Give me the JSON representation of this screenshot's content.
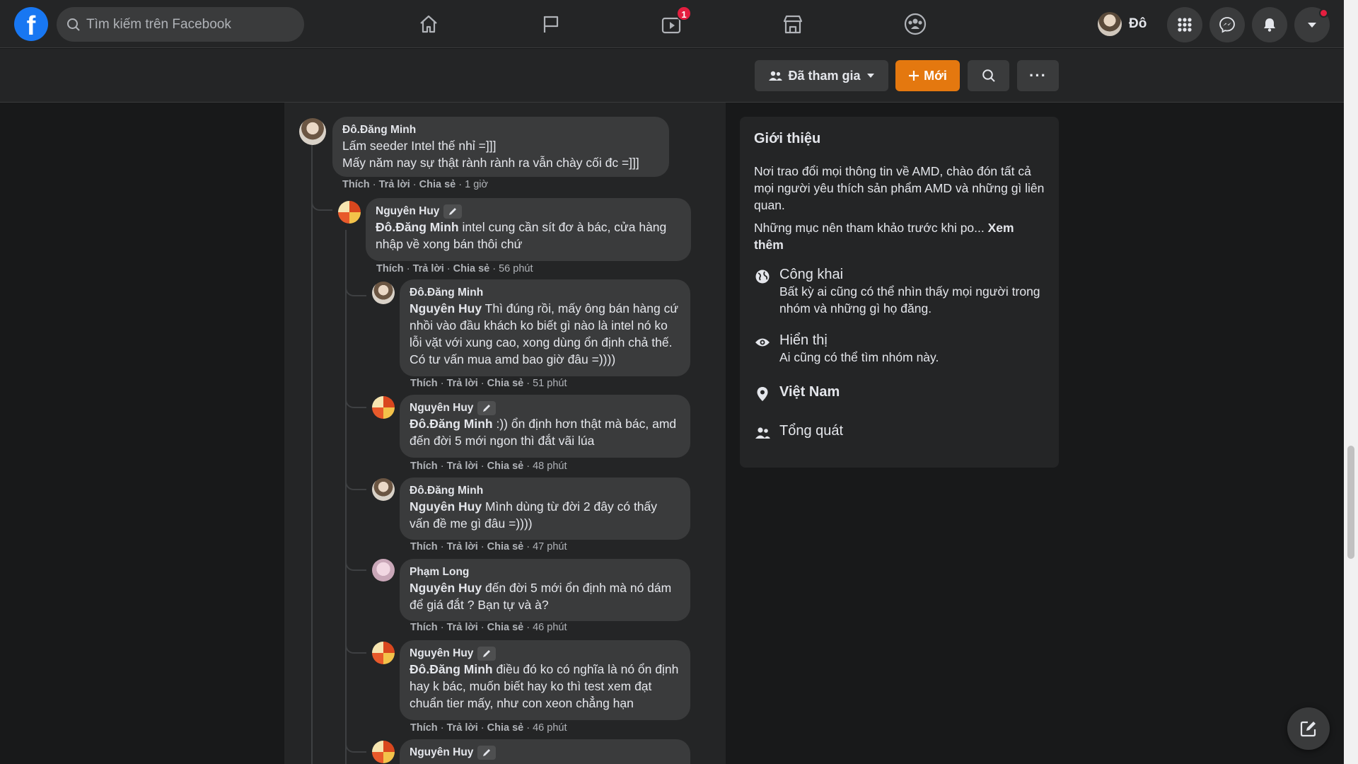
{
  "nav": {
    "logo": "f",
    "search_placeholder": "Tìm kiếm trên Facebook",
    "watch_badge": "1",
    "profile_name": "Đô"
  },
  "group_bar": {
    "joined_label": "Đã tham gia",
    "new_label": "Mới",
    "more_label": "···"
  },
  "comments": [
    {
      "author": "Đô.Đăng Minh",
      "lines": [
        "Lấm seeder Intel thế nhỉ =]]]",
        "Mấy năm nay sự thật rành rành ra vẫn chày cối đc =]]]"
      ],
      "mention": "",
      "time": "1 giờ"
    },
    {
      "author": "Nguyên Huy",
      "mention": "Đô.Đăng Minh",
      "text": " intel cung cần sít đơ à bác, cửa hàng nhập về xong bán thôi chứ",
      "time": "56 phút"
    },
    {
      "author": "Đô.Đăng Minh",
      "mention": "Nguyên Huy",
      "text": " Thì đúng rồi, mấy ông bán hàng cứ nhồi vào đầu khách ko biết gì nào là intel nó ko lỗi vặt với xung cao, xong dùng ổn định chả thế. Có tư vấn mua amd bao giờ đâu =))))",
      "time": "51 phút"
    },
    {
      "author": "Nguyên Huy",
      "mention": "Đô.Đăng Minh",
      "text": " :)) ổn định hơn thật mà bác, amd đến đời 5 mới ngon thì đắt vãi lúa",
      "time": "48 phút"
    },
    {
      "author": "Đô.Đăng Minh",
      "mention": "Nguyên Huy",
      "text": " Mình dùng từ đời 2 đây có thấy vấn đề me gì đâu =))))",
      "time": "47 phút"
    },
    {
      "author": "Phạm Long",
      "mention": "Nguyên Huy",
      "text": " đến đời 5 mới ổn định mà nó dám để giá đắt ? Bạn tự và à?",
      "time": "46 phút"
    },
    {
      "author": "Nguyên Huy",
      "mention": "Đô.Đăng Minh",
      "text": " điều đó ko có nghĩa là nó ổn định hay k bác, muốn biết hay ko thì test xem đạt chuẩn tier mấy, như con xeon chẳng hạn",
      "time": "46 phút"
    },
    {
      "author": "Nguyên Huy"
    }
  ],
  "actions": {
    "like": "Thích",
    "reply": "Trả lời",
    "share": "Chia sẻ"
  },
  "about": {
    "title": "Giới thiệu",
    "description": "Nơi trao đổi mọi thông tin về AMD, chào đón tất cả mọi người yêu thích sản phẩm AMD và những gì liên quan.",
    "rules_text": "Những mục nên tham khảo trước khi po... ",
    "see_more": "Xem thêm",
    "public_title": "Công khai",
    "public_desc": "Bất kỳ ai cũng có thể nhìn thấy mọi người trong nhóm và những gì họ đăng.",
    "visible_title": "Hiển thị",
    "visible_desc": "Ai cũng có thể tìm nhóm này.",
    "location": "Việt Nam",
    "general": "Tổng quát"
  }
}
